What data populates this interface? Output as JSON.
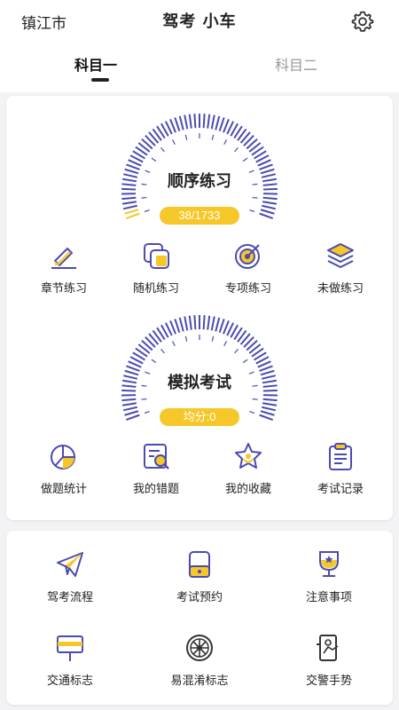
{
  "header": {
    "city": "镇江市",
    "title": "驾考 小车",
    "settings_icon": "gear-icon",
    "tabs": [
      {
        "label": "科目一",
        "active": true
      },
      {
        "label": "科目二",
        "active": false
      }
    ]
  },
  "practice": {
    "gauge_title": "顺序练习",
    "progress_text": "38/1733",
    "progress_fraction": 0.022,
    "items": [
      {
        "label": "章节练习",
        "icon": "pencil-icon"
      },
      {
        "label": "随机练习",
        "icon": "cards-icon"
      },
      {
        "label": "专项练习",
        "icon": "target-icon"
      },
      {
        "label": "未做练习",
        "icon": "layers-icon"
      }
    ]
  },
  "exam": {
    "gauge_title": "模拟考试",
    "score_text": "均分:0",
    "items": [
      {
        "label": "做题统计",
        "icon": "pie-chart-icon"
      },
      {
        "label": "我的错题",
        "icon": "wrong-answers-icon"
      },
      {
        "label": "我的收藏",
        "icon": "star-icon"
      },
      {
        "label": "考试记录",
        "icon": "clipboard-icon"
      }
    ]
  },
  "tools": {
    "items": [
      {
        "label": "驾考流程",
        "icon": "paper-plane-icon"
      },
      {
        "label": "考试预约",
        "icon": "appointment-icon"
      },
      {
        "label": "注意事项",
        "icon": "trophy-icon"
      },
      {
        "label": "交通标志",
        "icon": "road-sign-icon"
      },
      {
        "label": "易混淆标志",
        "icon": "wheel-icon"
      },
      {
        "label": "交警手势",
        "icon": "police-gesture-icon"
      }
    ]
  },
  "colors": {
    "accent_purple": "#4b4bb0",
    "accent_yellow": "#f6c729",
    "tick_color": "#4b4bb0"
  }
}
